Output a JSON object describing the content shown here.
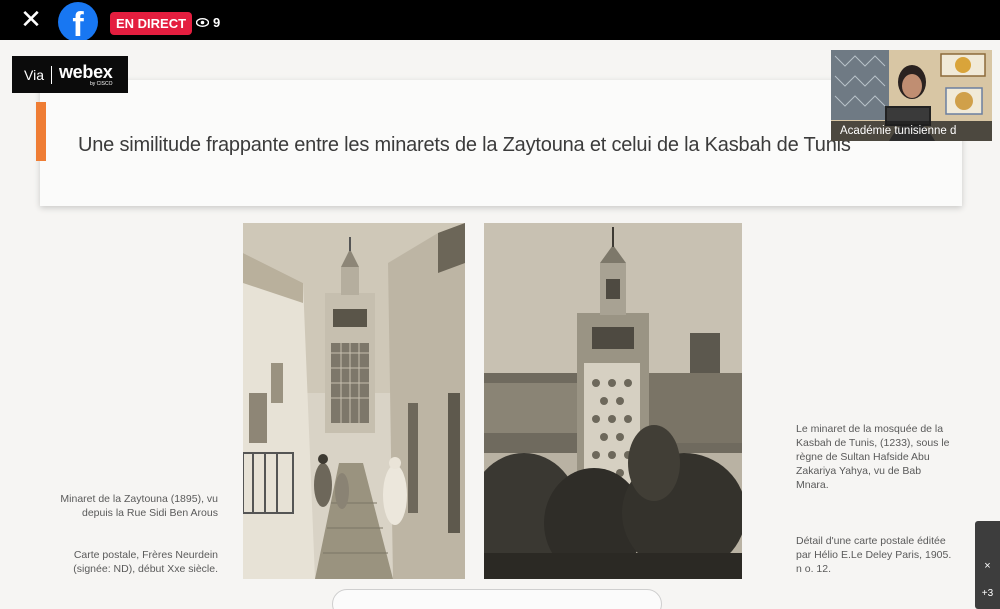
{
  "topbar": {
    "close_icon": "close-icon",
    "logo_icon": "facebook-logo",
    "logo_letter": "f",
    "live_label": "EN DIRECT",
    "viewer_count": "9",
    "viewer_icon": "eye-icon"
  },
  "webex": {
    "via": "Via",
    "brand": "webex",
    "by": "by CISCO"
  },
  "slide": {
    "title": "Une similitude frappante entre les minarets de la Zaytouna et celui de la Kasbah de Tunis",
    "left_caption_1": "Minaret de la Zaytouna (1895), vu depuis la Rue Sidi Ben Arous",
    "left_caption_2": "Carte postale, Frères Neurdein (signée: ND), début Xxe siècle.",
    "right_caption_1": "Le minaret de la mosquée de la Kasbah de Tunis, (1233), sous le règne de Sultan Hafside Abu Zakariya Yahya, vu de Bab Mnara.",
    "right_caption_2": "Détail d'une carte postale éditée par Hélio E.Le Deley Paris, 1905. n o. 12."
  },
  "camera": {
    "participant_label": "Académie tunisienne d"
  },
  "side_panel": {
    "close_label": "×",
    "more_label": "+3"
  },
  "colors": {
    "accent": "#ef7d34",
    "live_red": "#e41e3f",
    "facebook_blue": "#1877f2"
  }
}
